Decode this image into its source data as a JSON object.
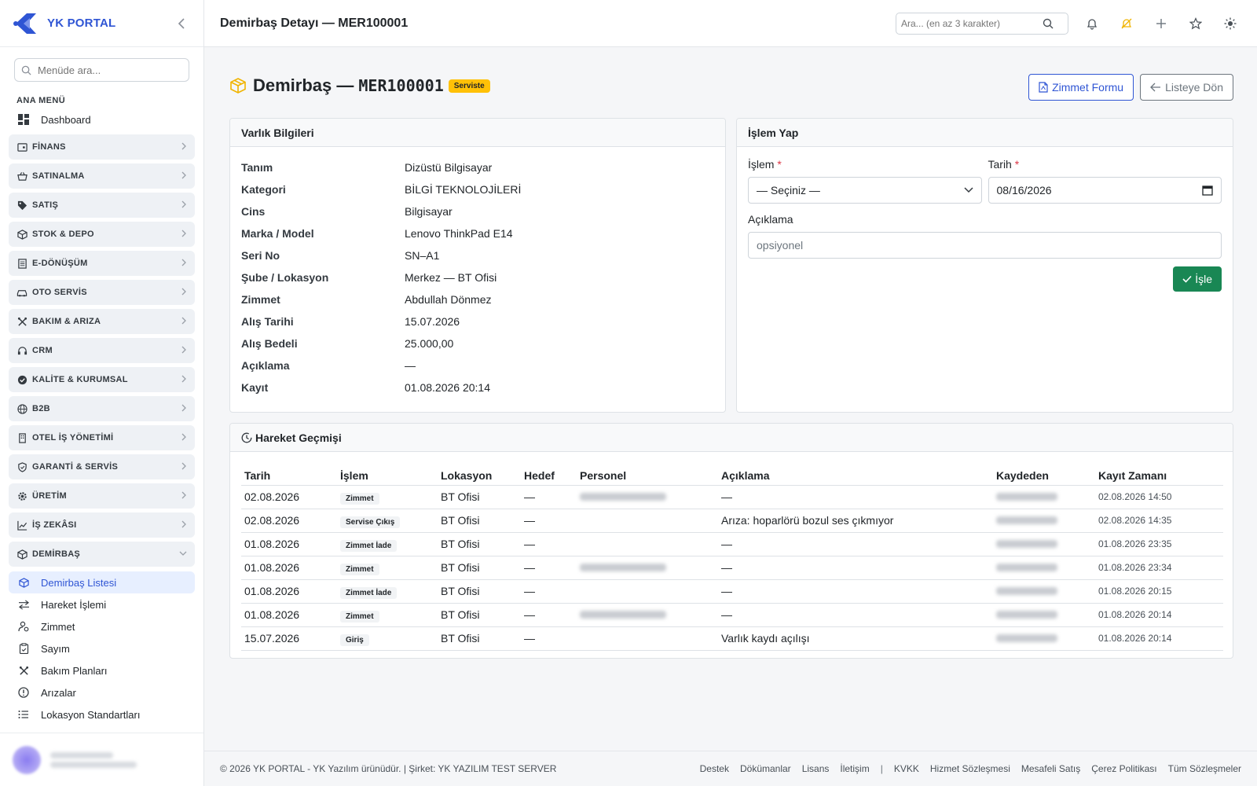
{
  "brand": {
    "name": "YK PORTAL"
  },
  "sidebar": {
    "search_placeholder": "Menüde ara...",
    "menu_title": "ANA MENÜ",
    "dashboard": "Dashboard",
    "groups": [
      {
        "label": "FİNANS",
        "icon": "finance-icon"
      },
      {
        "label": "SATINALMA",
        "icon": "basket-icon"
      },
      {
        "label": "SATIŞ",
        "icon": "tag-icon"
      },
      {
        "label": "STOK & DEPO",
        "icon": "box-icon"
      },
      {
        "label": "E-DÖNÜŞÜM",
        "icon": "document-icon"
      },
      {
        "label": "OTO SERVİS",
        "icon": "car-icon"
      },
      {
        "label": "BAKIM & ARIZA",
        "icon": "tools-icon"
      },
      {
        "label": "CRM",
        "icon": "headset-icon"
      },
      {
        "label": "KALİTE & KURUMSAL",
        "icon": "badge-check-icon"
      },
      {
        "label": "B2B",
        "icon": "globe-icon"
      },
      {
        "label": "OTEL İŞ YÖNETİMİ",
        "icon": "building-icon"
      },
      {
        "label": "GARANTİ & SERVİS",
        "icon": "shield-icon"
      },
      {
        "label": "ÜRETİM",
        "icon": "gear-icon"
      },
      {
        "label": "İŞ ZEKÂSI",
        "icon": "chart-icon"
      }
    ],
    "open_group": "DEMİRBAŞ",
    "subitems": [
      {
        "label": "Demirbaş Listesi",
        "icon": "box-icon",
        "active": true
      },
      {
        "label": "Hareket İşlemi",
        "icon": "arrows-icon"
      },
      {
        "label": "Zimmet",
        "icon": "user-icon"
      },
      {
        "label": "Sayım",
        "icon": "clipboard-icon"
      },
      {
        "label": "Bakım Planları",
        "icon": "tools-icon"
      },
      {
        "label": "Arızalar",
        "icon": "alert-icon"
      },
      {
        "label": "Lokasyon Standartları",
        "icon": "list-icon"
      }
    ]
  },
  "topbar": {
    "title": "Demirbaş Detayı — MER100001",
    "search_placeholder": "Ara... (en az 3 karakter)"
  },
  "header": {
    "title": "Demirbaş —",
    "code": "MER100001",
    "status": "Serviste",
    "btn_form": "Zimmet Formu",
    "btn_back": "Listeye Dön"
  },
  "asset": {
    "card_title": "Varlık Bilgileri",
    "rows": [
      {
        "k": "Tanım",
        "v": "Dizüstü Bilgisayar"
      },
      {
        "k": "Kategori",
        "v": "BİLGİ TEKNOLOJİLERİ"
      },
      {
        "k": "Cins",
        "v": "Bilgisayar"
      },
      {
        "k": "Marka / Model",
        "v": "Lenovo ThinkPad E14"
      },
      {
        "k": "Seri No",
        "v": "SN–A1"
      },
      {
        "k": "Şube / Lokasyon",
        "v": "Merkez — BT Ofisi"
      },
      {
        "k": "Zimmet",
        "v": "Abdullah Dönmez"
      },
      {
        "k": "Alış Tarihi",
        "v": "15.07.2026"
      },
      {
        "k": "Alış Bedeli",
        "v": "25.000,00"
      },
      {
        "k": "Açıklama",
        "v": "—"
      },
      {
        "k": "Kayıt",
        "v": "01.08.2026 20:14"
      }
    ]
  },
  "action": {
    "card_title": "İşlem Yap",
    "op_label": "İşlem",
    "op_value": "— Seçiniz —",
    "date_label": "Tarih",
    "date_value": "08/16/2026",
    "desc_label": "Açıklama",
    "desc_placeholder": "opsiyonel",
    "submit": "İşle",
    "req": "*"
  },
  "history": {
    "card_title": "Hareket Geçmişi",
    "columns": [
      "Tarih",
      "İşlem",
      "Lokasyon",
      "Hedef",
      "Personel",
      "Açıklama",
      "Kaydeden",
      "Kayıt Zamanı"
    ],
    "rows": [
      {
        "date": "02.08.2026",
        "op": "Zimmet",
        "loc": "BT Ofisi",
        "target": "—",
        "person": true,
        "desc": "—",
        "time": "02.08.2026 14:50"
      },
      {
        "date": "02.08.2026",
        "op": "Servise Çıkış",
        "loc": "BT Ofisi",
        "target": "—",
        "person": false,
        "desc": "Arıza: hoparlörü bozul ses çıkmıyor",
        "time": "02.08.2026 14:35"
      },
      {
        "date": "01.08.2026",
        "op": "Zimmet İade",
        "loc": "BT Ofisi",
        "target": "—",
        "person": false,
        "desc": "—",
        "time": "01.08.2026 23:35"
      },
      {
        "date": "01.08.2026",
        "op": "Zimmet",
        "loc": "BT Ofisi",
        "target": "—",
        "person": true,
        "desc": "—",
        "time": "01.08.2026 23:34"
      },
      {
        "date": "01.08.2026",
        "op": "Zimmet İade",
        "loc": "BT Ofisi",
        "target": "—",
        "person": false,
        "desc": "—",
        "time": "01.08.2026 20:15"
      },
      {
        "date": "01.08.2026",
        "op": "Zimmet",
        "loc": "BT Ofisi",
        "target": "—",
        "person": true,
        "desc": "—",
        "time": "01.08.2026 20:14"
      },
      {
        "date": "15.07.2026",
        "op": "Giriş",
        "loc": "BT Ofisi",
        "target": "—",
        "person": false,
        "desc": "Varlık kaydı açılışı",
        "time": "01.08.2026 20:14"
      }
    ]
  },
  "footer": {
    "left": "© 2026 YK PORTAL - YK Yazılım ürünüdür. | Şirket: YK YAZILIM TEST SERVER",
    "links_a": [
      "Destek",
      "Dökümanlar",
      "Lisans",
      "İletişim"
    ],
    "sep": "|",
    "links_b": [
      "KVKK",
      "Hizmet Sözleşmesi",
      "Mesafeli Satış",
      "Çerez Politikası",
      "Tüm Sözleşmeler"
    ]
  },
  "colors": {
    "accent": "#2f55d4",
    "warning": "#ffc107",
    "success": "#198754",
    "danger": "#dc3545"
  }
}
